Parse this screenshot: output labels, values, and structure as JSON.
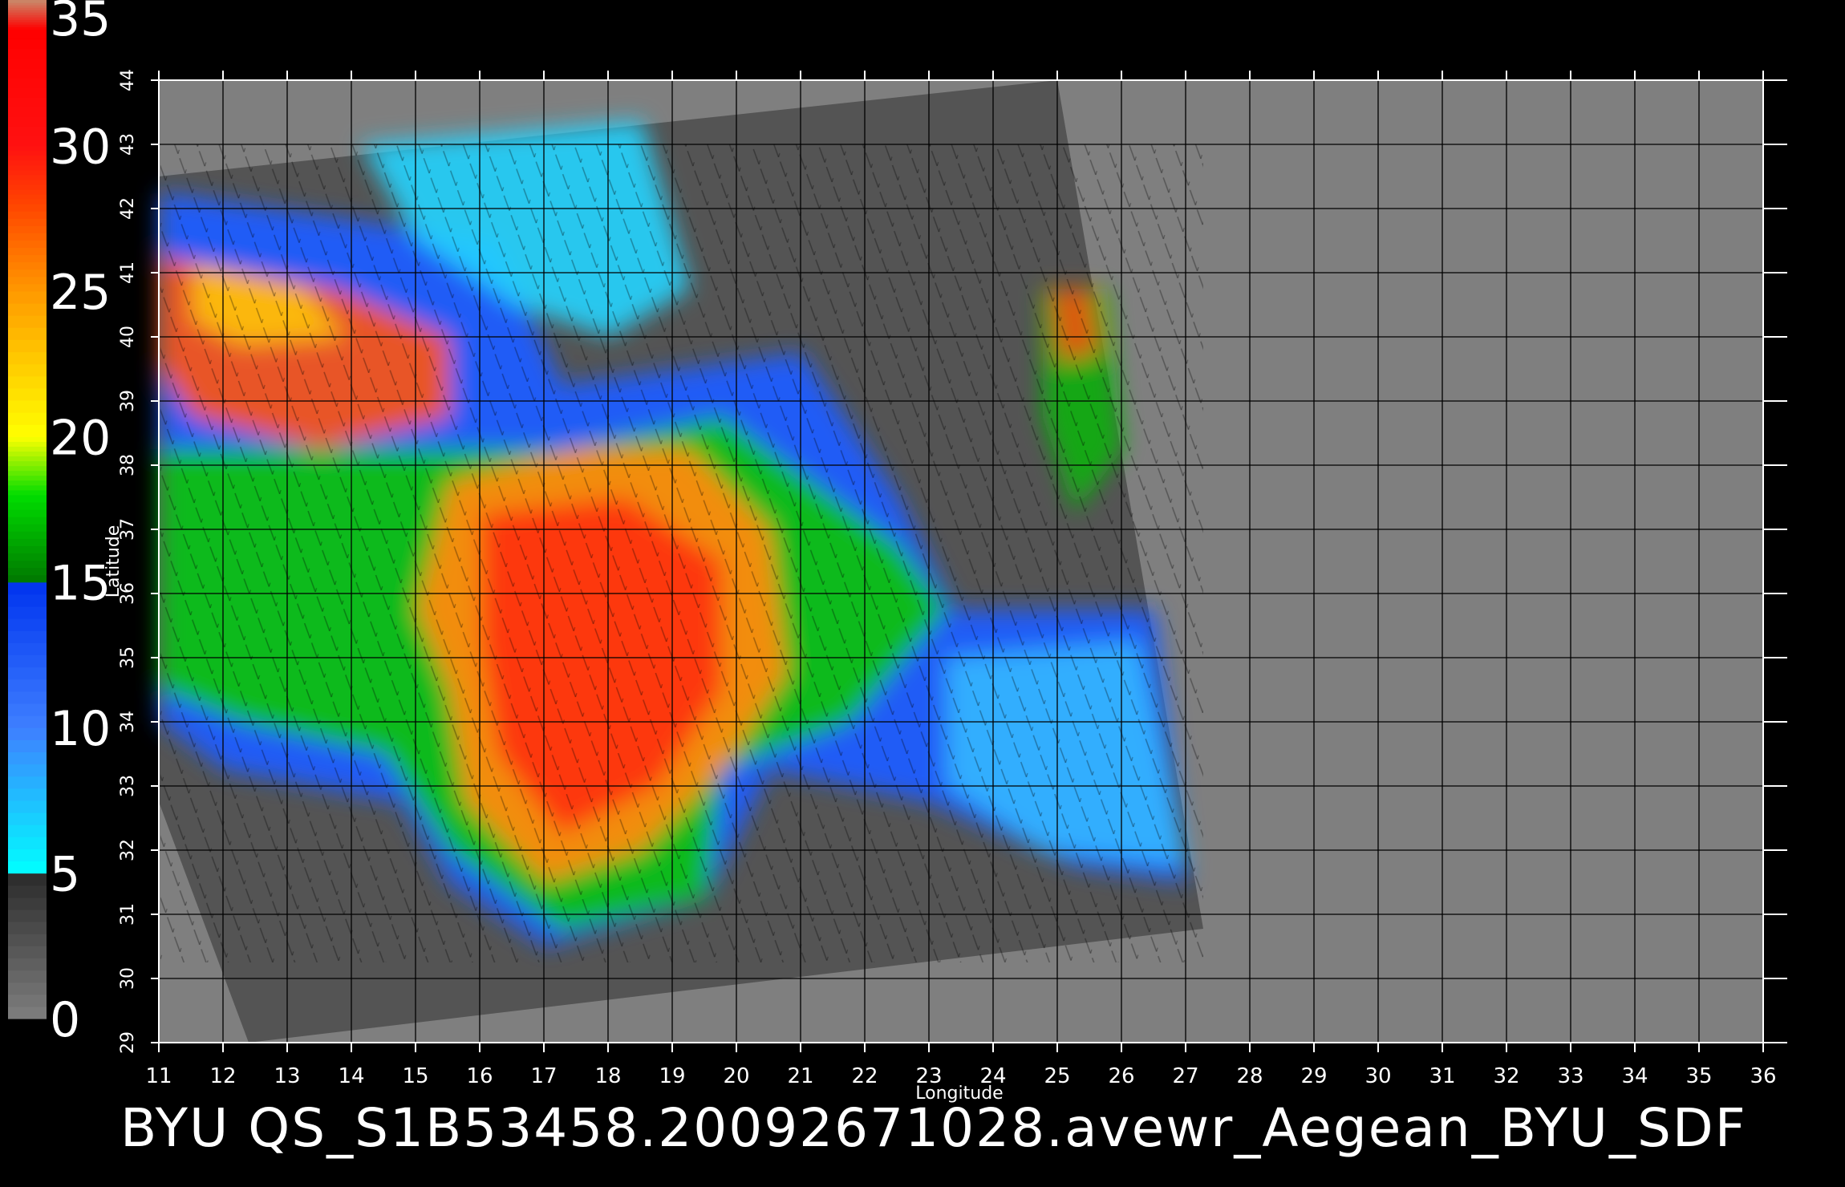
{
  "colorbar": {
    "labels": [
      "0",
      "5",
      "10",
      "15",
      "20",
      "25",
      "30",
      "35"
    ],
    "stops": [
      {
        "value": 0,
        "color": "#7f7f7f"
      },
      {
        "value": 5,
        "color": "#2a2a2a"
      },
      {
        "value": 5,
        "color": "#00ffff"
      },
      {
        "value": 10,
        "color": "#3f7fff"
      },
      {
        "value": 15,
        "color": "#0033ee"
      },
      {
        "value": 15,
        "color": "#007700"
      },
      {
        "value": 18,
        "color": "#00dd00"
      },
      {
        "value": 20,
        "color": "#ffff00"
      },
      {
        "value": 25,
        "color": "#ff9900"
      },
      {
        "value": 28,
        "color": "#ff4400"
      },
      {
        "value": 30,
        "color": "#ff1111"
      },
      {
        "value": 34,
        "color": "#ff0000"
      },
      {
        "value": 35,
        "color": "#c98a6a"
      }
    ]
  },
  "map": {
    "xlabel": "Longitude",
    "ylabel": "Latitude",
    "lon_range": [
      11,
      36
    ],
    "lat_range": [
      29,
      44
    ],
    "lon_ticks": [
      "11",
      "12",
      "13",
      "14",
      "15",
      "16",
      "17",
      "18",
      "19",
      "20",
      "21",
      "22",
      "23",
      "24",
      "25",
      "26",
      "27",
      "28",
      "29",
      "30",
      "31",
      "32",
      "33",
      "34",
      "35",
      "36"
    ],
    "lat_ticks": [
      "29",
      "30",
      "31",
      "32",
      "33",
      "34",
      "35",
      "36",
      "37",
      "38",
      "39",
      "40",
      "41",
      "42",
      "43",
      "44"
    ],
    "colors": {
      "background_gray": "#7f7f7f",
      "swath_dark": "#545454",
      "grid": "#000000"
    }
  },
  "caption": "BYU  QS_S1B53458.20092671028.avewr_Aegean_BYU_SDF"
}
